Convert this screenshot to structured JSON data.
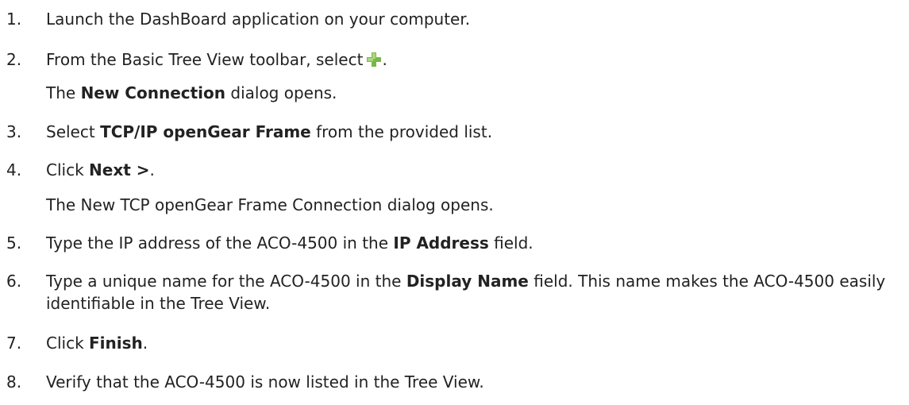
{
  "steps": [
    {
      "num": "1.",
      "parts": [
        "Launch the DashBoard application on your computer."
      ]
    },
    {
      "num": "2.",
      "pre": "From the Basic Tree View toolbar, select",
      "post": ".",
      "icon": "green-plus-icon"
    },
    {
      "num": "3.",
      "pre": "Select ",
      "bold": "TCP/IP openGear Frame",
      "post": " from the provided list."
    },
    {
      "num": "4.",
      "pre": "Click ",
      "bold": "Next >",
      "post": "."
    },
    {
      "num": "5.",
      "pre": "Type the IP address of the ACO-4500 in the ",
      "bold": "IP Address",
      "post": " field."
    },
    {
      "num": "6.",
      "pre": "Type a unique name for the ACO-4500 in the ",
      "bold": "Display Name",
      "post": " field. This name makes the ACO-4500 easily identifiable in the Tree View."
    },
    {
      "num": "7.",
      "pre": "Click ",
      "bold": "Finish",
      "post": "."
    },
    {
      "num": "8.",
      "parts": [
        "Verify that the ACO-4500 is now listed in the Tree View."
      ]
    }
  ],
  "notes": {
    "after_step_2_pre": "The ",
    "after_step_2_bold": "New Connection",
    "after_step_2_post": " dialog opens.",
    "after_step_4": "The New TCP openGear Frame Connection dialog opens."
  },
  "colors": {
    "plus_icon_green": "#7ab648",
    "text": "#222222"
  }
}
